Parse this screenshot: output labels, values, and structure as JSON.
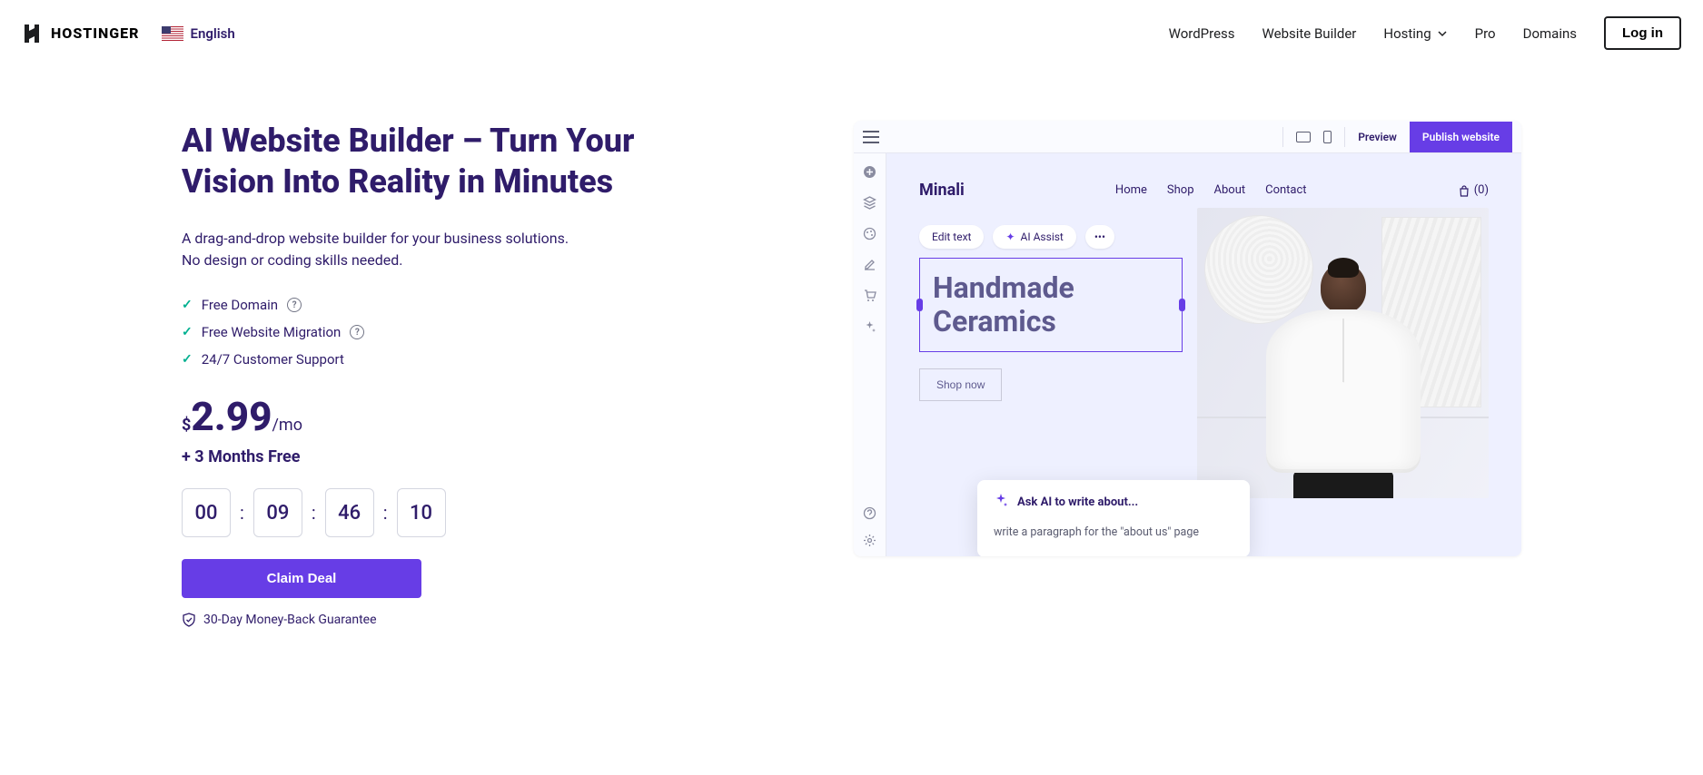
{
  "header": {
    "brand": "HOSTINGER",
    "lang": "English",
    "nav": {
      "wordpress": "WordPress",
      "builder": "Website Builder",
      "hosting": "Hosting",
      "pro": "Pro",
      "domains": "Domains"
    },
    "login": "Log in"
  },
  "hero": {
    "heading": "AI Website Builder – Turn Your Vision Into Reality in Minutes",
    "sub1": "A drag-and-drop website builder for your business solutions.",
    "sub2": "No design or coding skills needed.",
    "features": {
      "f1": "Free Domain",
      "f2": "Free Website Migration",
      "f3": "24/7 Customer Support"
    },
    "price": {
      "currency": "$",
      "value": "2.99",
      "per": "/mo"
    },
    "bonus": "+ 3 Months Free",
    "timer": {
      "d": "00",
      "h": "09",
      "m": "46",
      "s": "10"
    },
    "cta": "Claim Deal",
    "guarantee": "30-Day Money-Back Guarantee"
  },
  "preview": {
    "topbar": {
      "preview": "Preview",
      "publish": "Publish website"
    },
    "site": {
      "logo": "Minali",
      "nav": {
        "home": "Home",
        "shop": "Shop",
        "about": "About",
        "contact": "Contact"
      },
      "cart": "(0)"
    },
    "editbar": {
      "edit": "Edit text",
      "ai": "AI Assist"
    },
    "heroTitle": "Handmade Ceramics",
    "shopnow": "Shop now",
    "ai": {
      "label": "Ask AI to write about...",
      "prompt": "write a paragraph for the \"about us\" page"
    }
  }
}
